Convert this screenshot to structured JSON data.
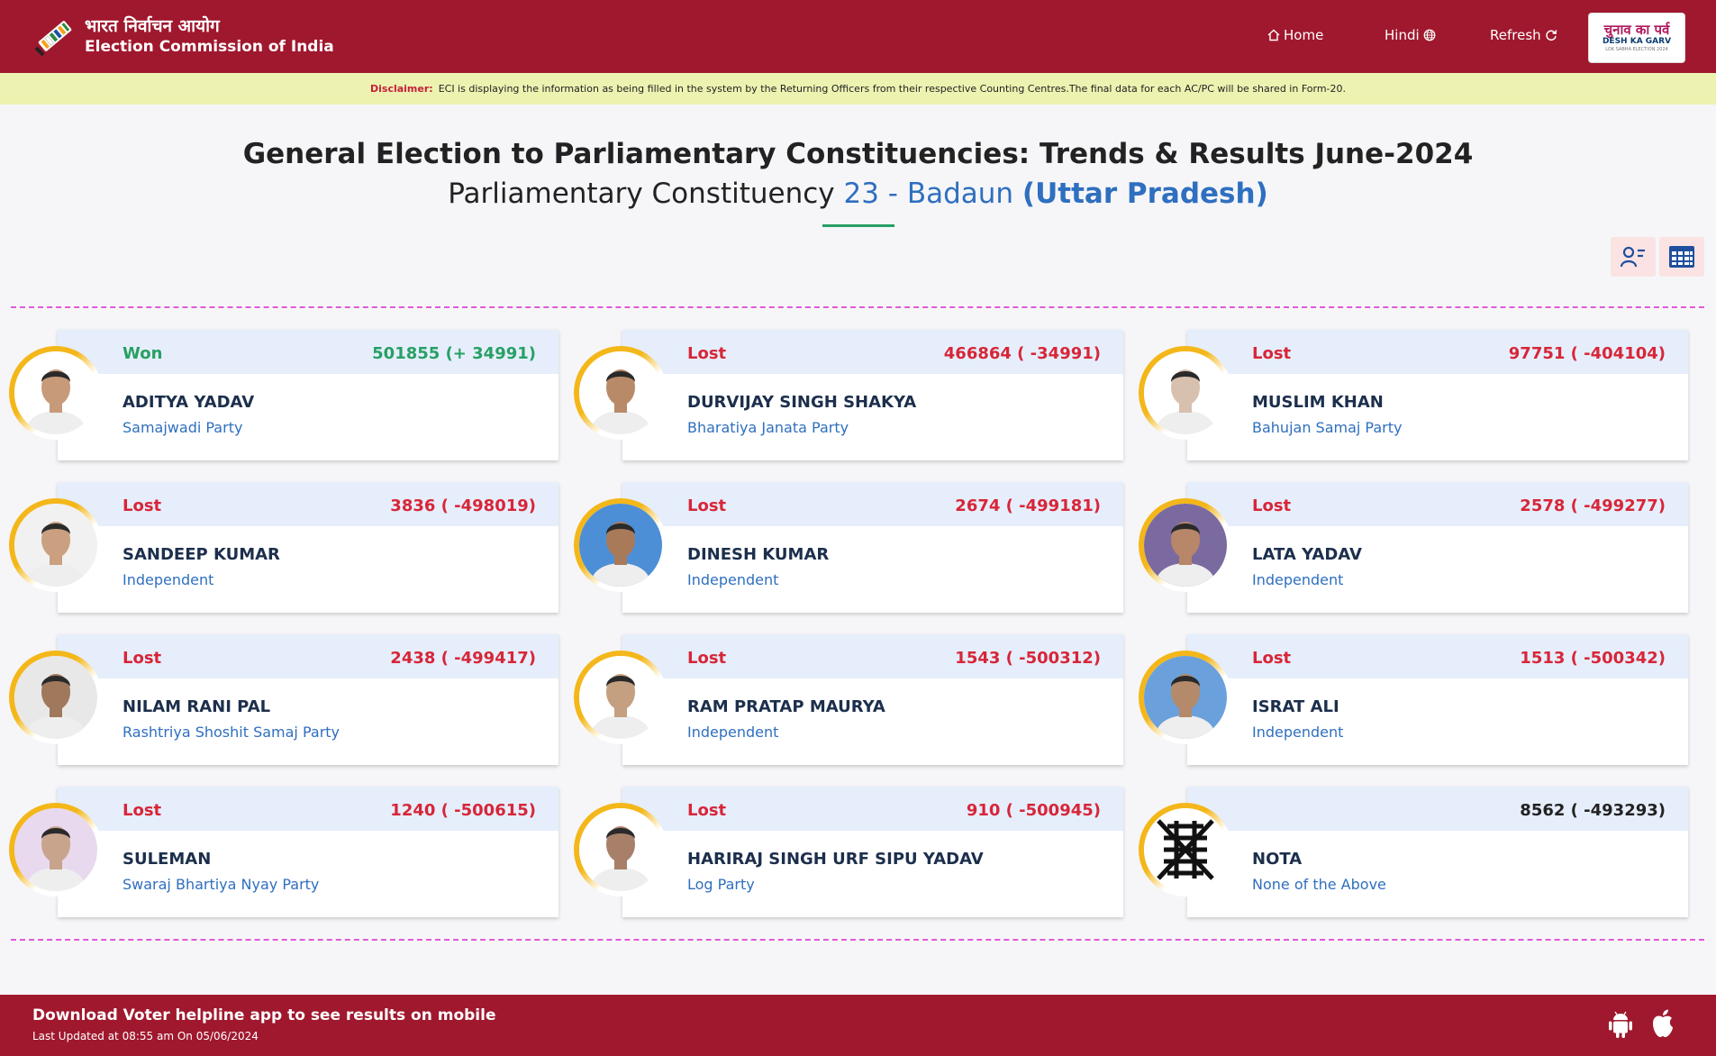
{
  "header": {
    "brand_hindi": "भारत निर्वाचन आयोग",
    "brand_english": "Election Commission of India",
    "nav": {
      "home": "Home",
      "hindi": "Hindi",
      "refresh": "Refresh"
    },
    "badge": {
      "line1": "चुनाव का पर्व",
      "line2": "DESH KA GARV",
      "line3": "LOK SABHA ELECTION 2024"
    }
  },
  "disclaimer": {
    "label": "Disclaimer:",
    "text": "ECI is displaying the information as being filled in the system by the Returning Officers from their respective Counting Centres.The final data for each AC/PC will be shared in Form-20."
  },
  "title": {
    "line1": "General Election to Parliamentary Constituencies: Trends & Results June-2024",
    "line2_prefix": "Parliamentary Constituency",
    "pc": "23 - Badaun",
    "state": "(Uttar Pradesh)"
  },
  "candidates": [
    {
      "status": "Won",
      "votes": "501855 (+ 34991)",
      "name": "ADITYA YADAV",
      "party": "Samajwadi Party"
    },
    {
      "status": "Lost",
      "votes": "466864 ( -34991)",
      "name": "DURVIJAY SINGH SHAKYA",
      "party": "Bharatiya Janata Party"
    },
    {
      "status": "Lost",
      "votes": "97751 ( -404104)",
      "name": "MUSLIM KHAN",
      "party": "Bahujan Samaj Party"
    },
    {
      "status": "Lost",
      "votes": "3836 ( -498019)",
      "name": "SANDEEP KUMAR",
      "party": "Independent"
    },
    {
      "status": "Lost",
      "votes": "2674 ( -499181)",
      "name": "DINESH KUMAR",
      "party": "Independent"
    },
    {
      "status": "Lost",
      "votes": "2578 ( -499277)",
      "name": "LATA YADAV",
      "party": "Independent"
    },
    {
      "status": "Lost",
      "votes": "2438 ( -499417)",
      "name": "NILAM RANI PAL",
      "party": "Rashtriya Shoshit Samaj Party"
    },
    {
      "status": "Lost",
      "votes": "1543 ( -500312)",
      "name": "RAM PRATAP MAURYA",
      "party": "Independent"
    },
    {
      "status": "Lost",
      "votes": "1513 ( -500342)",
      "name": "ISRAT ALI",
      "party": "Independent"
    },
    {
      "status": "Lost",
      "votes": "1240 ( -500615)",
      "name": "SULEMAN",
      "party": "Swaraj Bhartiya Nyay Party"
    },
    {
      "status": "Lost",
      "votes": "910 ( -500945)",
      "name": "HARIRAJ SINGH URF SIPU YADAV",
      "party": "Log Party"
    },
    {
      "status": "",
      "votes": "8562 ( -493293)",
      "name": "NOTA",
      "party": "None of the Above"
    }
  ],
  "footer": {
    "title": "Download Voter helpline app to see results on mobile",
    "updated": "Last Updated at 08:55 am On 05/06/2024"
  },
  "colors": {
    "brand": "#a0182e",
    "won": "#27a064",
    "lost": "#d72638",
    "party": "#2f6fbf",
    "disclaimer_bg": "#edf2b1"
  }
}
